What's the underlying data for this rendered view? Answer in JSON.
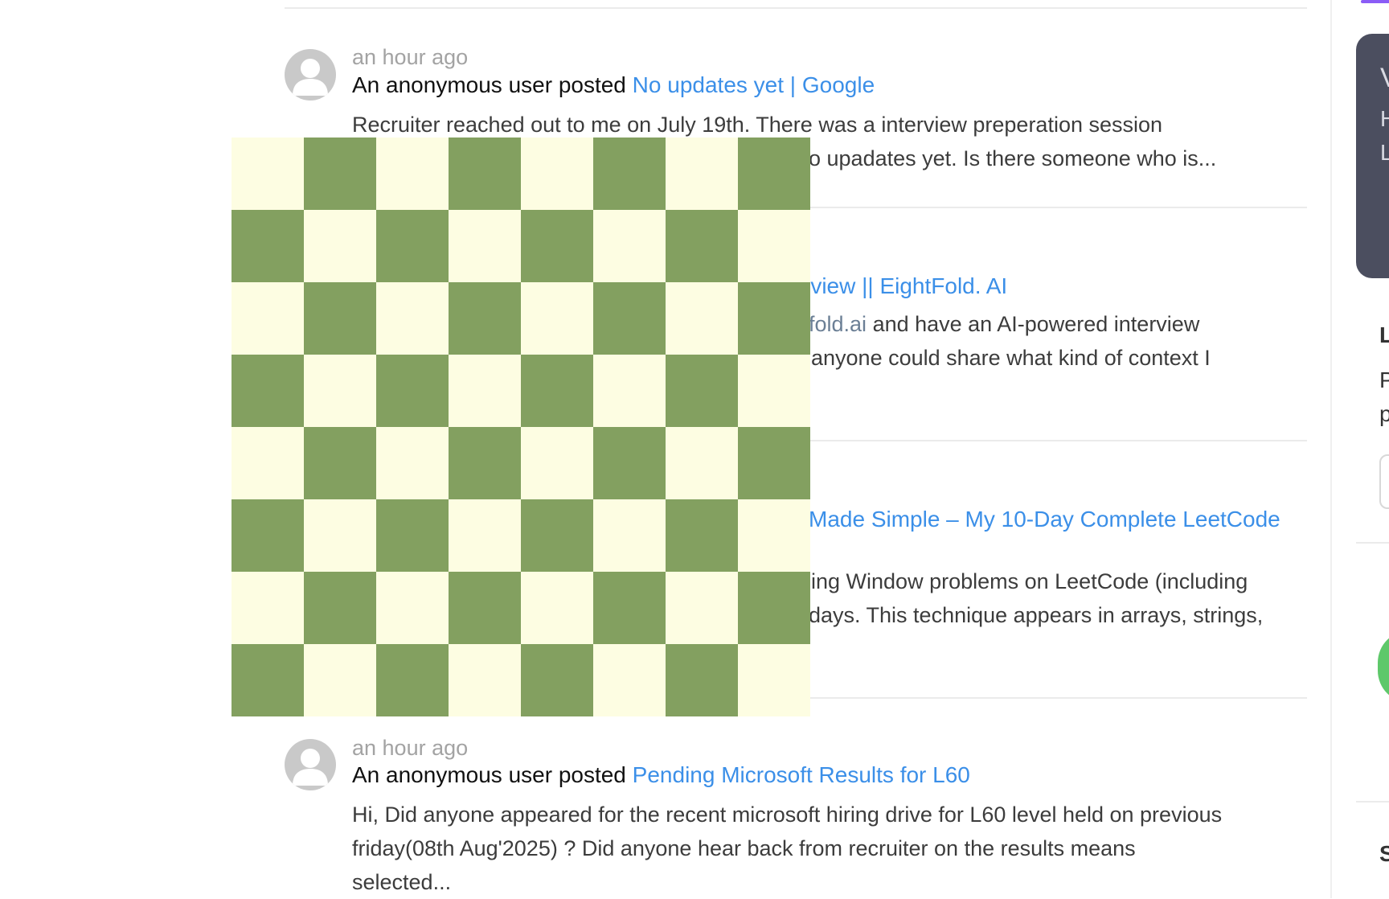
{
  "feed": {
    "posts": [
      {
        "time": "an hour ago",
        "actor": "An anonymous user posted",
        "title": "No updates yet | Google",
        "excerpt_line1": "Recruiter reached out to me on July 19th. There was a interview preperation session",
        "excerpt_line2_visible": "o upadates yet. Is there someone who is..."
      },
      {
        "title_visible": "rview || EightFold. AI",
        "excerpt_line1_link": "fold.ai",
        "excerpt_line1_rest": " and have an AI-powered interview",
        "excerpt_line2_visible": "anyone could share what kind of context I"
      },
      {
        "title_visible": "Made Simple – My 10-Day Complete LeetCode",
        "excerpt_line1_visible": "ing Window problems on LeetCode (including",
        "excerpt_line2_visible": "days. This technique appears in arrays, strings,"
      },
      {
        "time": "an hour ago",
        "actor": "An anonymous user posted",
        "title": "Pending Microsoft Results for L60",
        "excerpt_line1": "Hi, Did anyone appeared for the recent microsoft hiring drive for L60 level held on previous",
        "excerpt_line2": "friday(08th Aug'2025) ? Did anyone hear back from recruiter on the results means",
        "excerpt_line3": "selected..."
      }
    ]
  },
  "overlay": {
    "type": "checkerboard",
    "rows": 8,
    "cols": 8,
    "light_color": "#fdfde2",
    "dark_color": "#83a060"
  },
  "sidebar": {
    "promo_letters": [
      "V",
      "H",
      "L"
    ],
    "section_letter_1": "L",
    "para_letters": [
      "P",
      "p"
    ],
    "section_letter_2": "S"
  }
}
